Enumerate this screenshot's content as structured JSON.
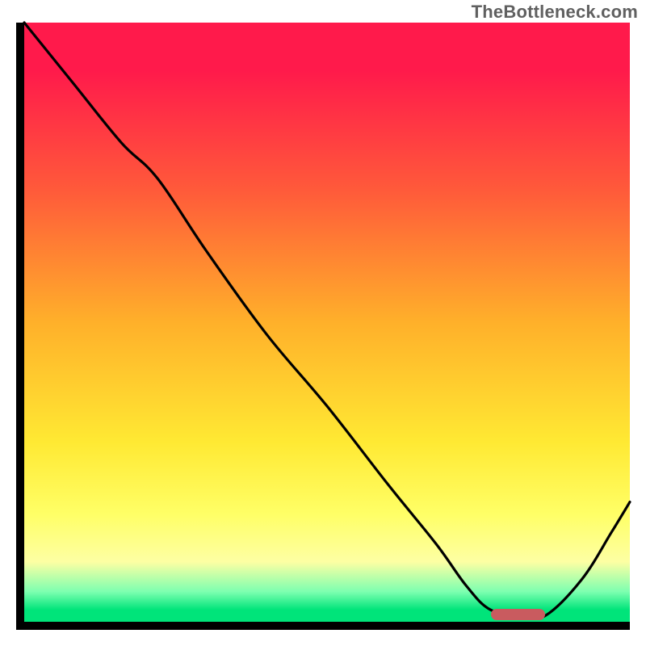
{
  "watermark": "TheBottleneck.com",
  "colors": {
    "gradient_top": "#ff1a4b",
    "gradient_mid_1": "#ff5a3a",
    "gradient_mid_2": "#ffb02a",
    "gradient_mid_3": "#ffe933",
    "gradient_mid_4": "#ffff66",
    "gradient_mid_5": "#fdffa3",
    "gradient_mid_6": "#7cffb0",
    "gradient_bottom": "#00e47a",
    "curve": "#000000",
    "axes": "#000000",
    "marker": "#c95b5f"
  },
  "chart_data": {
    "type": "line",
    "title": "",
    "xlabel": "",
    "ylabel": "",
    "xlim": [
      0,
      100
    ],
    "ylim": [
      0,
      100
    ],
    "grid": false,
    "note": "No numeric tick labels are visible; x and y are treated as 0-100% of the plotting area (left-to-right, bottom-to-top). Values are visual estimates of the black curve.",
    "series": [
      {
        "name": "bottleneck-curve",
        "x": [
          0,
          8,
          16,
          22,
          30,
          40,
          50,
          60,
          68,
          73,
          77,
          82,
          86,
          92,
          97,
          100
        ],
        "y": [
          100,
          90,
          80,
          74,
          62,
          48,
          36,
          23,
          13,
          6,
          2,
          1.0,
          1.0,
          7,
          15,
          20
        ]
      }
    ],
    "marker": {
      "name": "optimal-range",
      "x_start": 77,
      "x_end": 86,
      "y": 1.2
    }
  }
}
